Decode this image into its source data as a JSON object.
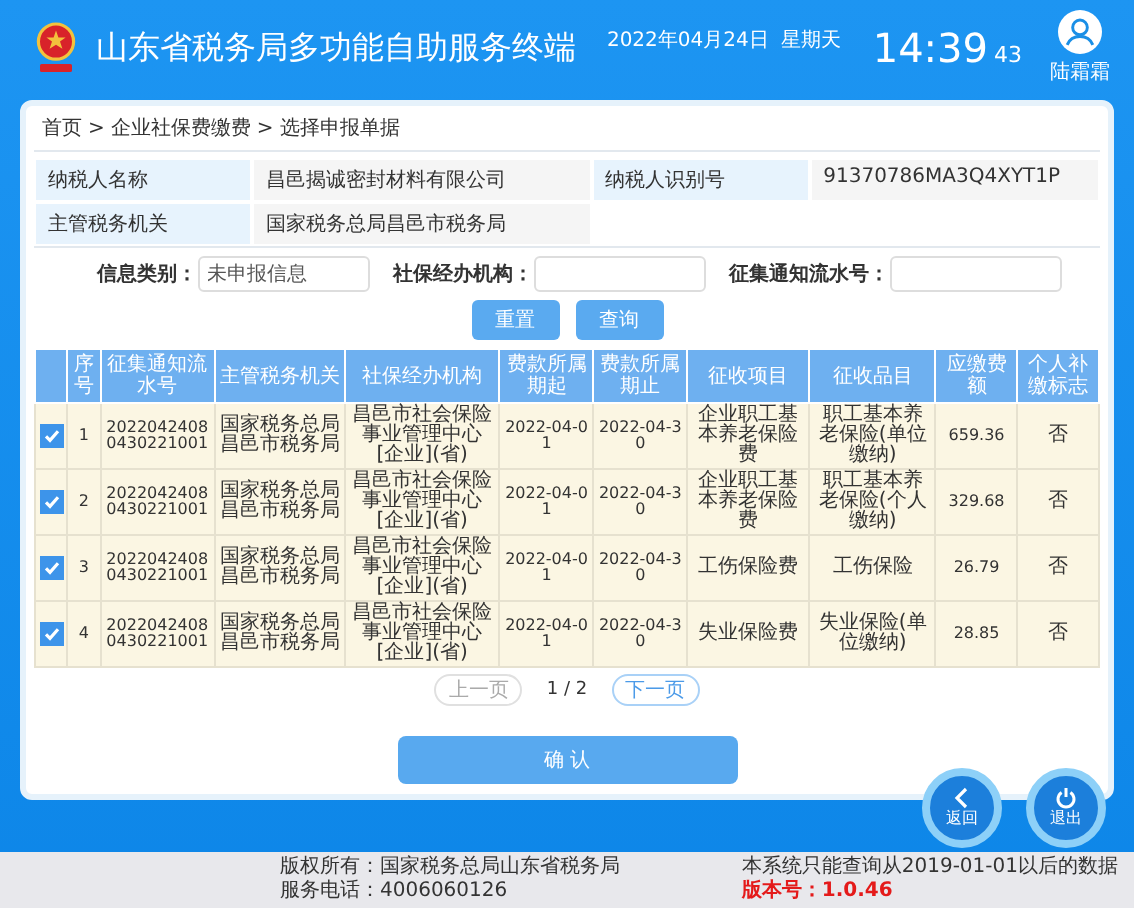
{
  "header": {
    "title": "山东省税务局多功能自助服务终端",
    "date": "2022年04月24日",
    "weekday": "星期天",
    "time": "14:39",
    "seconds": "43",
    "user": "陆霜霜"
  },
  "breadcrumb": {
    "separator": ">",
    "items": [
      "首页",
      "企业社保费缴费",
      "选择申报单据"
    ]
  },
  "info": [
    {
      "label": "纳税人名称",
      "value": "昌邑揭诚密封材料有限公司"
    },
    {
      "label": "纳税人识别号",
      "value": "91370786MA3Q4XYT1P"
    },
    {
      "label": "主管税务机关",
      "value": "国家税务总局昌邑市税务局"
    }
  ],
  "filters": [
    {
      "label": "信息类别：",
      "value": "未申报信息"
    },
    {
      "label": "社保经办机构："
    },
    {
      "label": "征集通知流水号："
    }
  ],
  "filter_buttons": [
    "重置",
    "查询"
  ],
  "table": {
    "columns": [
      "序号",
      "征集通知流水号",
      "主管税务机关",
      "社保经办机构",
      "费款所属期起",
      "费款所属期止",
      "征收项目",
      "征收品目",
      "应缴费额",
      "个人补缴标志"
    ],
    "rows": [
      {
        "checked": true,
        "cells": [
          "1",
          "20220424080430221001",
          "国家税务总局昌邑市税务局",
          "昌邑市社会保险事业管理中心[企业](省)",
          "2022-04-01",
          "2022-04-30",
          "企业职工基本养老保险费",
          "职工基本养老保险(单位缴纳)",
          "659.36",
          "否"
        ]
      },
      {
        "checked": true,
        "cells": [
          "2",
          "20220424080430221001",
          "国家税务总局昌邑市税务局",
          "昌邑市社会保险事业管理中心[企业](省)",
          "2022-04-01",
          "2022-04-30",
          "企业职工基本养老保险费",
          "职工基本养老保险(个人缴纳)",
          "329.68",
          "否"
        ]
      },
      {
        "checked": true,
        "cells": [
          "3",
          "20220424080430221001",
          "国家税务总局昌邑市税务局",
          "昌邑市社会保险事业管理中心[企业](省)",
          "2022-04-01",
          "2022-04-30",
          "工伤保险费",
          "工伤保险",
          "26.79",
          "否"
        ]
      },
      {
        "checked": true,
        "cells": [
          "4",
          "20220424080430221001",
          "国家税务总局昌邑市税务局",
          "昌邑市社会保险事业管理中心[企业](省)",
          "2022-04-01",
          "2022-04-30",
          "失业保险费",
          "失业保险(单位缴纳)",
          "28.85",
          "否"
        ]
      }
    ]
  },
  "pagination": {
    "prev": {
      "label": "上一页",
      "disabled": true
    },
    "page": "1 / 2",
    "next": {
      "label": "下一页",
      "disabled": false
    }
  },
  "confirm": "确 认",
  "actions": [
    {
      "kind": "back",
      "label": "返回"
    },
    {
      "kind": "exit",
      "label": "退出"
    }
  ],
  "footer": {
    "copyright": "版权所有：国家税务总局山东省税务局",
    "phone": "服务电话：4006060126",
    "notice": "本系统只能查询从2019-01-01以后的数据",
    "version": "版本号：1.0.46"
  }
}
